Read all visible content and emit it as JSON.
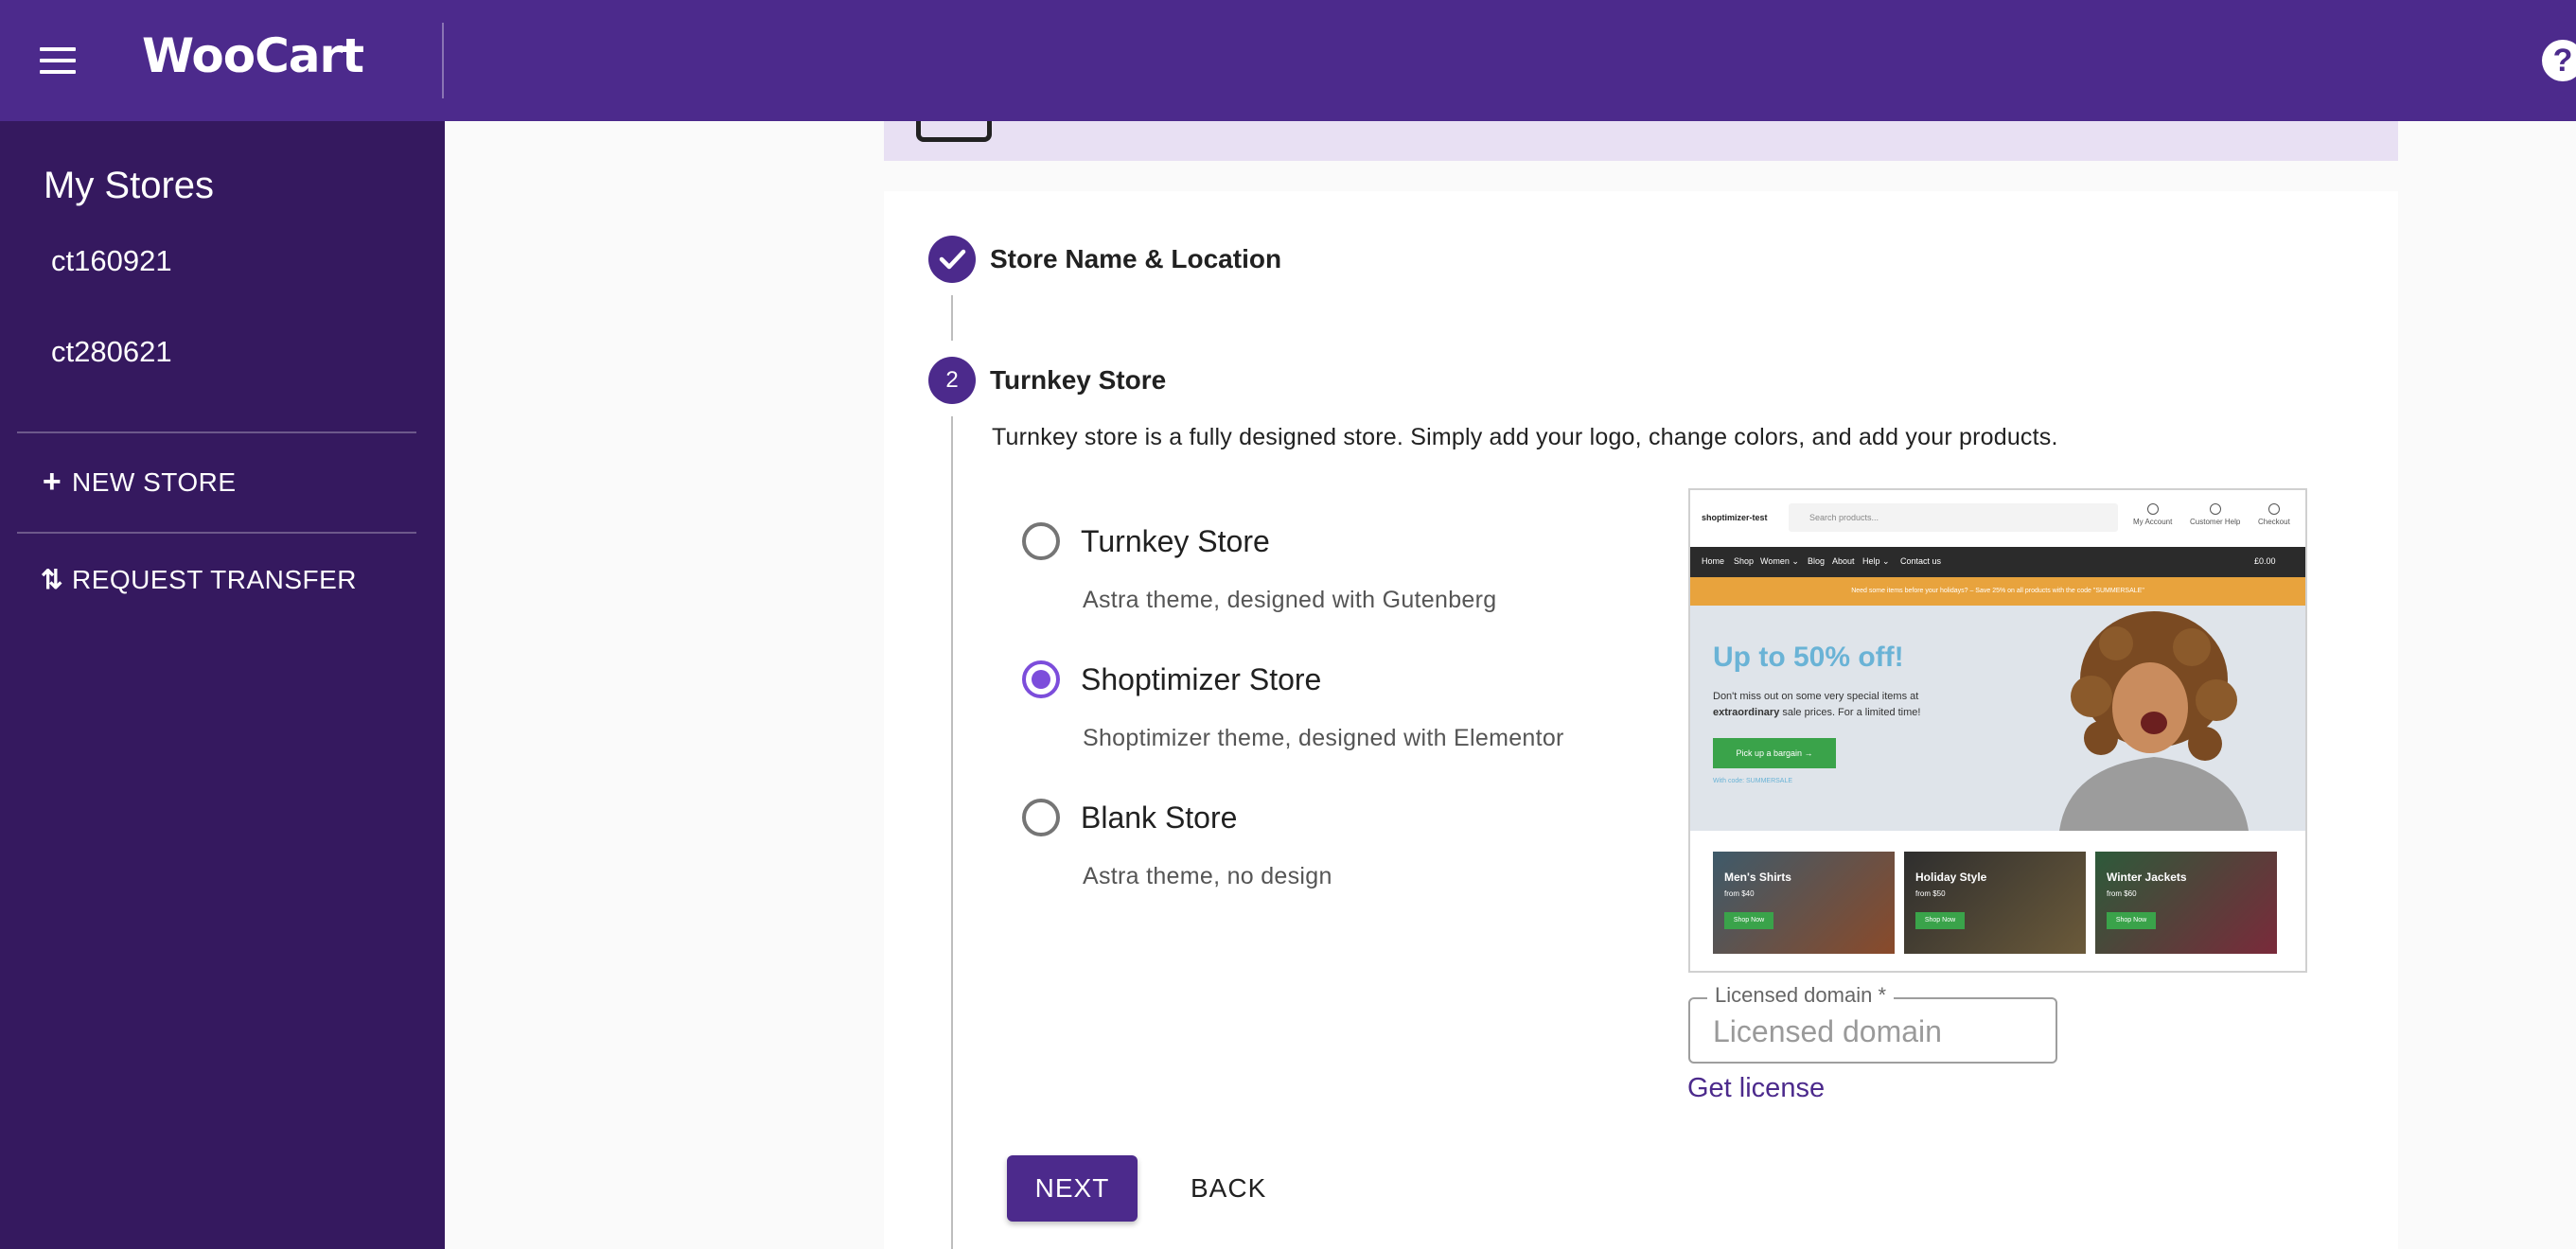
{
  "header": {
    "logo": "WooCart",
    "help_icon": "help-icon",
    "menu_icon": "hamburger-menu-icon",
    "color": "#4c2a8c"
  },
  "sidebar": {
    "title": "My Stores",
    "stores": [
      "ct160921",
      "ct280621"
    ],
    "new_store": "NEW STORE",
    "request_transfer": "REQUEST TRANSFER",
    "color": "#35195f"
  },
  "steps": [
    {
      "number": "",
      "label": "Store Name & Location",
      "status": "complete",
      "icon": "check-icon"
    },
    {
      "number": "2",
      "label": "Turnkey Store",
      "status": "active"
    }
  ],
  "turnkey": {
    "description": "Turnkey store is a fully designed store. Simply add your logo, change colors, and add your products.",
    "options": [
      {
        "label": "Turnkey Store",
        "desc": "Astra theme, designed with Gutenberg",
        "selected": false
      },
      {
        "label": "Shoptimizer Store",
        "desc": "Shoptimizer theme, designed with Elementor",
        "selected": true
      },
      {
        "label": "Blank Store",
        "desc": "Astra theme, no design",
        "selected": false
      }
    ]
  },
  "preview": {
    "brand": "shoptimizer-test",
    "search_placeholder": "Search products...",
    "header_links": [
      "My Account",
      "Customer Help",
      "Checkout"
    ],
    "nav": [
      "Home",
      "Shop",
      "Women ⌄",
      "Blog",
      "About",
      "Help ⌄",
      "Contact us"
    ],
    "cart": "£0.00",
    "promo": "Need some items before your holidays? – Save 25% on all products with the code \"SUMMERSALE\"",
    "hero_title": "Up to 50% off!",
    "hero_text_pre": "Don't miss out on some very special items at ",
    "hero_text_bold": "extraordinary",
    "hero_text_post": " sale prices. For a limited time!",
    "hero_button": "Pick up a bargain →",
    "hero_code": "With code: SUMMERSALE",
    "tiles": [
      {
        "title": "Men's Shirts",
        "price": "from $40",
        "button": "Shop Now"
      },
      {
        "title": "Holiday Style",
        "price": "from $50",
        "button": "Shop Now"
      },
      {
        "title": "Winter Jackets",
        "price": "from $60",
        "button": "Shop Now"
      }
    ]
  },
  "license": {
    "label": "Licensed domain *",
    "placeholder": "Licensed domain",
    "value": "",
    "link": "Get license"
  },
  "actions": {
    "next": "NEXT",
    "back": "BACK"
  }
}
